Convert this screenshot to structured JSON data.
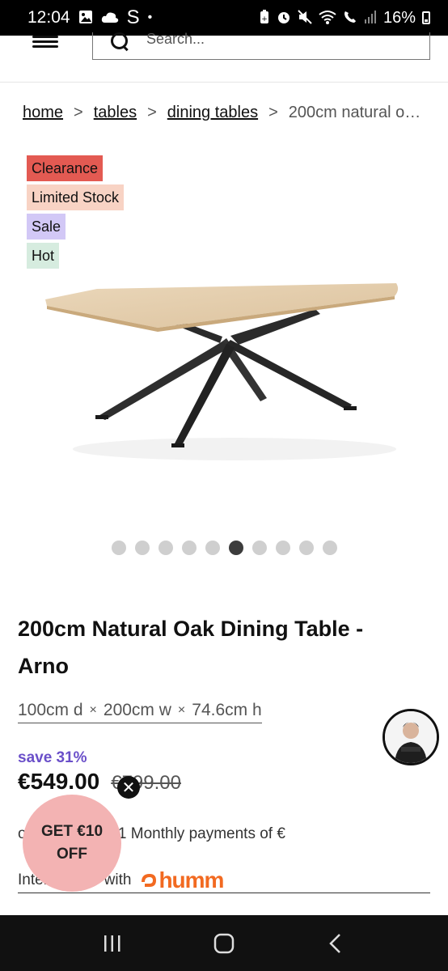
{
  "status_bar": {
    "time": "12:04",
    "s_label": "S",
    "dot": "•",
    "battery_pct": "16%"
  },
  "header": {
    "search_placeholder": "Search..."
  },
  "breadcrumb": {
    "items": [
      "home",
      "tables",
      "dining tables"
    ],
    "separator": ">",
    "current": "200cm natural o…"
  },
  "badges": [
    {
      "label": "Clearance",
      "color": "#e35a52"
    },
    {
      "label": "Limited Stock",
      "color": "#f8d3c4"
    },
    {
      "label": "Sale",
      "color": "#d2c8f6"
    },
    {
      "label": "Hot",
      "color": "#d6ecdf"
    }
  ],
  "gallery": {
    "count": 10,
    "active_index": 5
  },
  "product": {
    "title": "200cm Natural Oak Dining Table - Arno",
    "dim_d": "100cm d",
    "dim_w": "200cm w",
    "dim_h": "74.6cm h",
    "dim_sep": "×",
    "save": "save 31%",
    "price": "€549.00",
    "was_price": "€799.00",
    "installment_text": "or today, and 11 Monthly payments of €",
    "humm_prefix": "Interest free with",
    "humm_brand": "humm"
  },
  "promo": {
    "line1": "GET €10",
    "line2": "OFF"
  },
  "colors": {
    "accent_purple": "#6a4fc9",
    "promo_pink": "#f3b3b3",
    "humm_orange": "#f26a21"
  }
}
